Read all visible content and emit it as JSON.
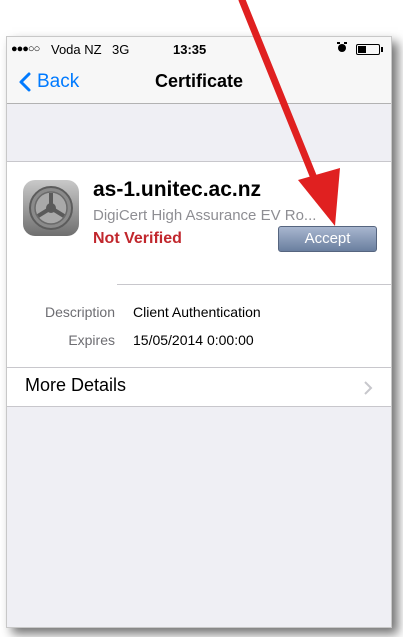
{
  "status_bar": {
    "signal": "●●●○○",
    "carrier": "Voda NZ",
    "network": "3G",
    "time": "13:35"
  },
  "nav": {
    "back_label": "Back",
    "title": "Certificate"
  },
  "certificate": {
    "name": "as-1.unitec.ac.nz",
    "issuer": "DigiCert High Assurance EV Ro...",
    "status": "Not Verified",
    "accept_label": "Accept"
  },
  "details": [
    {
      "label": "Description",
      "value": "Client Authentication"
    },
    {
      "label": "Expires",
      "value": "15/05/2014 0:00:00"
    }
  ],
  "more_details_label": "More Details",
  "colors": {
    "accent": "#007aff",
    "not_verified": "#c1272d",
    "annotation_arrow": "#e02020"
  }
}
